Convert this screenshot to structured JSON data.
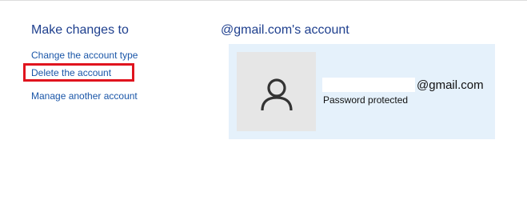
{
  "left_panel": {
    "heading": "Make changes to",
    "links": [
      {
        "label": "Change the account type"
      },
      {
        "label": "Delete the account"
      },
      {
        "label": "Manage another account"
      }
    ]
  },
  "right_panel": {
    "heading": "@gmail.com's account",
    "account": {
      "email_suffix": "@gmail.com",
      "status": "Password protected",
      "avatar_icon": "user-silhouette-icon"
    }
  },
  "highlight": {
    "target": "Delete the account",
    "color": "#e0141e"
  },
  "colors": {
    "heading": "#1e3f8e",
    "link": "#1a56a8",
    "panel_background": "#e5f1fb"
  }
}
